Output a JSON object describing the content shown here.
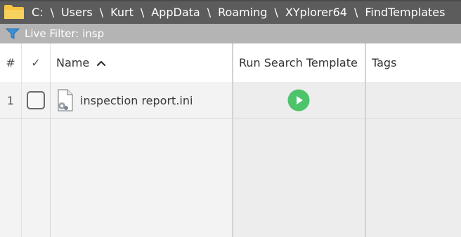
{
  "address_bar": {
    "path": [
      "C:",
      "Users",
      "Kurt",
      "AppData",
      "Roaming",
      "XYplorer64",
      "FindTemplates"
    ],
    "separator": "\\"
  },
  "filter_bar": {
    "text": "Live Filter: insp"
  },
  "columns": {
    "number": "#",
    "check": "✓",
    "name": "Name",
    "run": "Run Search Template",
    "tags": "Tags"
  },
  "rows": [
    {
      "number": "1",
      "checked": false,
      "name": "inspection report.ini",
      "tags": ""
    }
  ],
  "colors": {
    "address_bg": "#5c5c5c",
    "filter_bg": "#b4b4b4",
    "play_green": "#4cc46a",
    "folder_yellow": "#f6c343"
  }
}
